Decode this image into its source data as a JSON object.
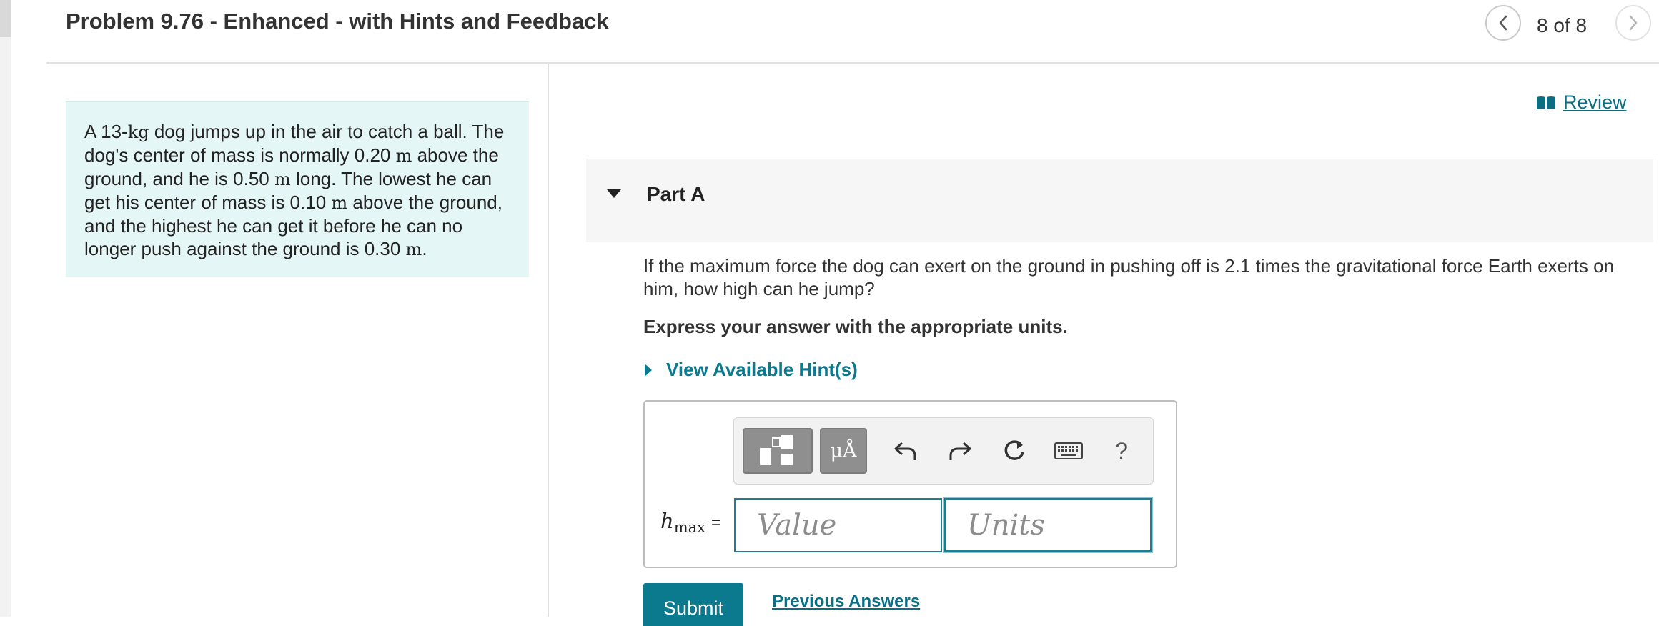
{
  "header": {
    "title": "Problem 9.76 - Enhanced - with Hints and Feedback",
    "counter": "8 of 8"
  },
  "problem": {
    "p1": "A 13-",
    "u1": "kg",
    "p2": " dog jumps up in the air to catch a ball. The dog's center of mass is normally 0.20 ",
    "u2": "m",
    "p3": " above the ground, and he is 0.50 ",
    "u3": "m",
    "p4": " long. The lowest he can get his center of mass is 0.10 ",
    "u4": "m",
    "p5": " above the ground, and the highest he can get it before he can no longer push against the ground is 0.30 ",
    "u5": "m",
    "p6": "."
  },
  "review": {
    "label": "Review"
  },
  "part": {
    "title": "Part A",
    "question": "If the maximum force the dog can exert on the ground in pushing off is 2.1 times the gravitational force Earth exerts on him, how high can he jump?",
    "instruction": "Express your answer with the appropriate units.",
    "hints_label": "View Available Hint(s)"
  },
  "answer": {
    "variable": "h",
    "subscript": "max",
    "equals": "=",
    "value_placeholder": "Value",
    "units_placeholder": "Units",
    "units_button_label": "μÅ",
    "help_label": "?"
  },
  "actions": {
    "submit_label": "Submit",
    "previous_answers_label": "Previous Answers"
  },
  "colors": {
    "accent": "#0b7a8f",
    "link": "#0b6f83",
    "statement_bg": "#e5f6f7"
  }
}
